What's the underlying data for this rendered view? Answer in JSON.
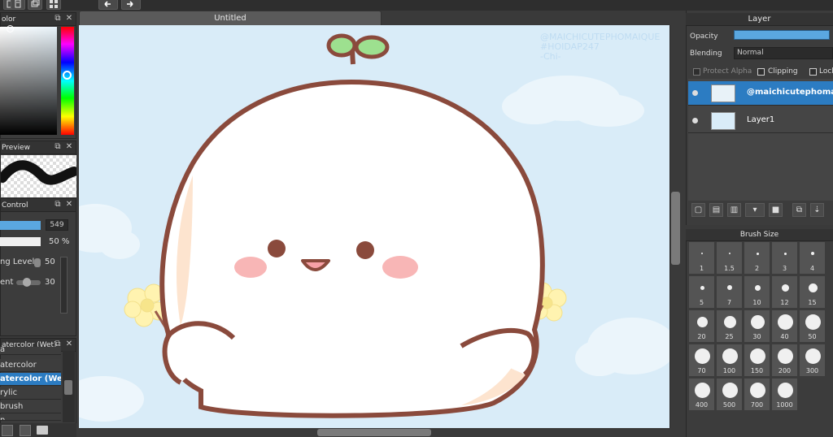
{
  "toolbar": {
    "buttons": [
      "save-icon",
      "doc-icon",
      "layers-icon",
      "grid-icon",
      "undo-icon",
      "redo-icon"
    ]
  },
  "panels": {
    "color": {
      "title": "olor"
    },
    "preview": {
      "title": "Preview"
    },
    "control": {
      "title": "Control",
      "size_value": "549",
      "opacity_value": "50 %",
      "rows": [
        {
          "label": "ng Level",
          "value": "50"
        },
        {
          "label": "ent",
          "value": "30"
        }
      ]
    },
    "brush": {
      "title": "atercolor (Wet)",
      "items": [
        {
          "label": "a"
        },
        {
          "label": "atercolor"
        },
        {
          "label": "atercolor (We",
          "selected": true
        },
        {
          "label": "rylic"
        },
        {
          "label": "brush"
        },
        {
          "label": "n"
        }
      ]
    }
  },
  "canvas": {
    "tab_title": "Untitled",
    "watermark": [
      "@MAICHICUTEPHOMAIQUE",
      "#HOIDAP247",
      "-Chi-"
    ]
  },
  "layer_panel": {
    "title": "Layer",
    "opacity_label": "Opacity",
    "opacity_value": 1.0,
    "blending_label": "Blending",
    "blending_value": "Normal",
    "protect_alpha": "Protect Alpha",
    "clipping": "Clipping",
    "lock": "Lock",
    "layers": [
      {
        "name": "@maichicutephomai",
        "selected": true
      },
      {
        "name": "Layer1",
        "selected": false
      }
    ]
  },
  "brush_size": {
    "title": "Brush Size",
    "sizes": [
      "1",
      "1.5",
      "2",
      "3",
      "4",
      "5",
      "7",
      "10",
      "12",
      "15",
      "20",
      "25",
      "30",
      "40",
      "50",
      "70",
      "100",
      "150",
      "200",
      "300",
      "400",
      "500",
      "700",
      "1000"
    ]
  },
  "colors": {
    "accent": "#2c7cc2",
    "canvas_bg": "#d9ecf8",
    "outline": "#8a4a3c"
  }
}
